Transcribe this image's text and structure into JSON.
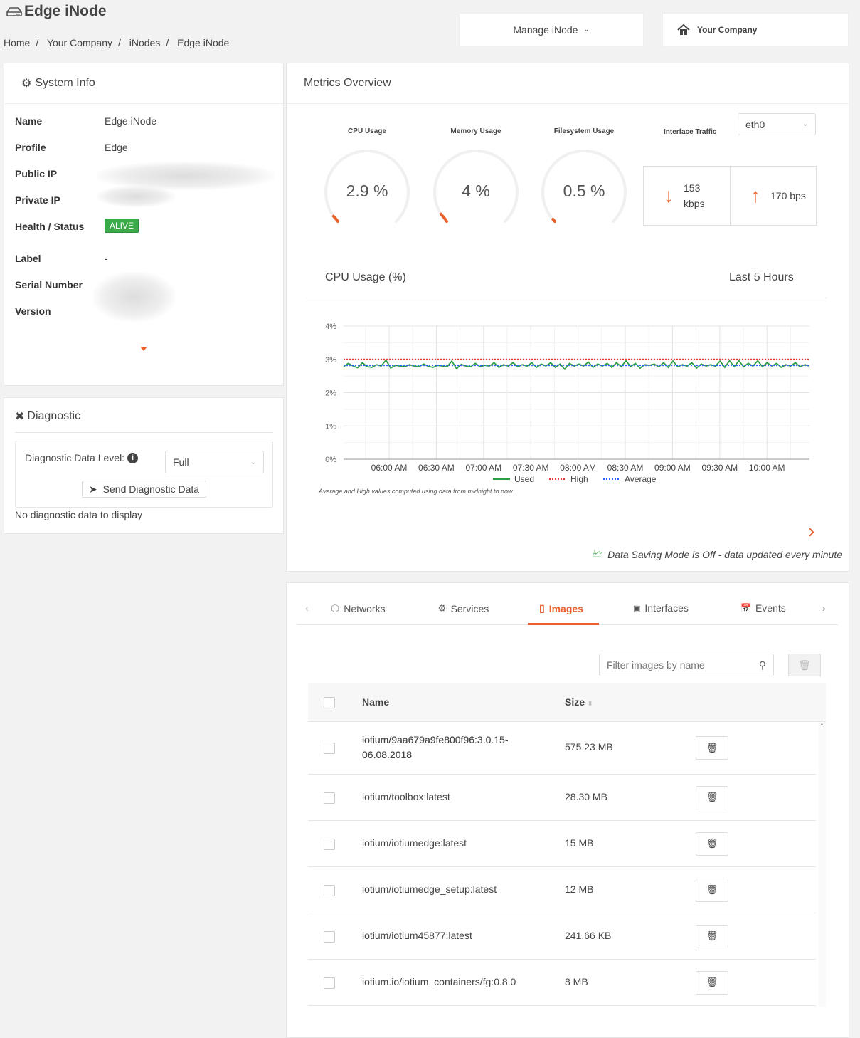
{
  "header": {
    "title": "Edge iNode",
    "breadcrumb": [
      "Home",
      "Your Company",
      "iNodes",
      "Edge iNode"
    ],
    "manage_label": "Manage iNode",
    "company_label": "Your Company"
  },
  "system_info": {
    "title": "System Info",
    "fields": [
      {
        "label": "Name",
        "value": "Edge iNode"
      },
      {
        "label": "Profile",
        "value": "Edge"
      },
      {
        "label": "Public IP",
        "value": ""
      },
      {
        "label": "Private IP",
        "value": ""
      },
      {
        "label": "Health / Status",
        "value": "ALIVE"
      },
      {
        "label": "Label",
        "value": "-"
      },
      {
        "label": "Serial Number",
        "value": ""
      },
      {
        "label": "Version",
        "value": ""
      }
    ]
  },
  "diagnostic": {
    "title": "Diagnostic",
    "level_label": "Diagnostic Data Level:",
    "level_value": "Full",
    "send_label": "Send Diagnostic Data",
    "empty_text": "No diagnostic data to display"
  },
  "metrics": {
    "title": "Metrics Overview",
    "gauges": [
      {
        "label": "CPU Usage",
        "value": "2.9 %",
        "fraction": 0.029
      },
      {
        "label": "Memory Usage",
        "value": "4 %",
        "fraction": 0.04
      },
      {
        "label": "Filesystem Usage",
        "value": "0.5 %",
        "fraction": 0.005
      }
    ],
    "traffic": {
      "label": "Interface Traffic",
      "interface": "eth0",
      "down_value": "153",
      "down_unit": "kbps",
      "up_value": "170 bps"
    },
    "chart_title": "CPU Usage (%)",
    "range_label": "Last 5 Hours",
    "footnote": "Average and High values computed using data from midnight to now",
    "saving_mode": "Data Saving Mode is Off - data updated every minute",
    "accent": "#e8602c"
  },
  "chart_data": {
    "type": "line",
    "ylim": [
      0,
      4
    ],
    "yticks": [
      "0%",
      "1%",
      "2%",
      "3%",
      "4%"
    ],
    "xlim": [
      "05:31 AM",
      "10:24 AM"
    ],
    "xticks": [
      "06:00 AM",
      "06:30 AM",
      "07:00 AM",
      "07:30 AM",
      "08:00 AM",
      "08:30 AM",
      "09:00 AM",
      "09:30 AM",
      "10:00 AM"
    ],
    "grid": true,
    "legend": "bottom",
    "series": [
      {
        "name": "Used",
        "color": "#2e9e44",
        "style": "solid",
        "values": [
          2.78,
          2.88,
          2.8,
          2.75,
          2.9,
          2.78,
          2.76,
          2.84,
          2.8,
          2.98,
          2.74,
          2.82,
          2.8,
          2.78,
          2.84,
          2.8,
          2.78,
          2.86,
          2.79,
          2.76,
          2.82,
          2.8,
          2.78,
          2.95,
          2.72,
          2.85,
          2.8,
          2.78,
          2.88,
          2.78,
          2.82,
          2.8,
          2.9,
          2.76,
          2.84,
          2.8,
          2.9,
          2.78,
          2.84,
          2.8,
          2.9,
          2.76,
          2.86,
          2.8,
          2.9,
          2.76,
          2.86,
          2.7,
          2.88,
          2.8,
          2.86,
          2.8,
          2.92,
          2.76,
          2.86,
          2.8,
          2.88,
          2.76,
          2.9,
          2.78,
          2.96,
          2.78,
          2.88,
          2.74,
          2.84,
          2.82,
          2.86,
          2.78,
          2.9,
          2.76,
          2.95,
          2.78,
          2.84,
          2.8,
          2.9,
          2.74,
          2.86,
          2.8,
          2.84,
          2.8,
          2.95,
          2.76,
          2.96,
          2.78,
          2.96,
          2.78,
          2.88,
          2.8,
          2.96,
          2.78,
          2.9,
          2.8,
          2.88,
          2.76,
          2.84,
          2.8,
          2.9,
          2.78,
          2.84,
          2.8
        ]
      },
      {
        "name": "High",
        "color": "#e53935",
        "style": "dotted",
        "values": [
          3.0
        ]
      },
      {
        "name": "Average",
        "color": "#2962ff",
        "style": "dotted",
        "values": [
          2.82
        ]
      }
    ]
  },
  "tabs": {
    "items": [
      {
        "label": "Networks"
      },
      {
        "label": "Services"
      },
      {
        "label": "Images",
        "active": true
      },
      {
        "label": "Interfaces"
      },
      {
        "label": "Events"
      }
    ]
  },
  "images": {
    "filter_placeholder": "Filter images by name",
    "columns": [
      "Name",
      "Size"
    ],
    "rows": [
      {
        "name": "iotium/9aa679a9fe800f96:3.0.15-06.08.2018",
        "name_l1": "iotium/9aa679a9fe800f96:3.0.15-",
        "name_l2": "06.08.2018",
        "size": "575.23 MB"
      },
      {
        "name": "iotium/toolbox:latest",
        "size": "28.30 MB"
      },
      {
        "name": "iotium/iotiumedge:latest",
        "size": "15 MB"
      },
      {
        "name": "iotium/iotiumedge_setup:latest",
        "size": "12 MB"
      },
      {
        "name": "iotium/iotium45877:latest",
        "size": "241.66 KB"
      },
      {
        "name": "iotium.io/iotium_containers/fg:0.8.0",
        "size": "8 MB"
      }
    ]
  }
}
